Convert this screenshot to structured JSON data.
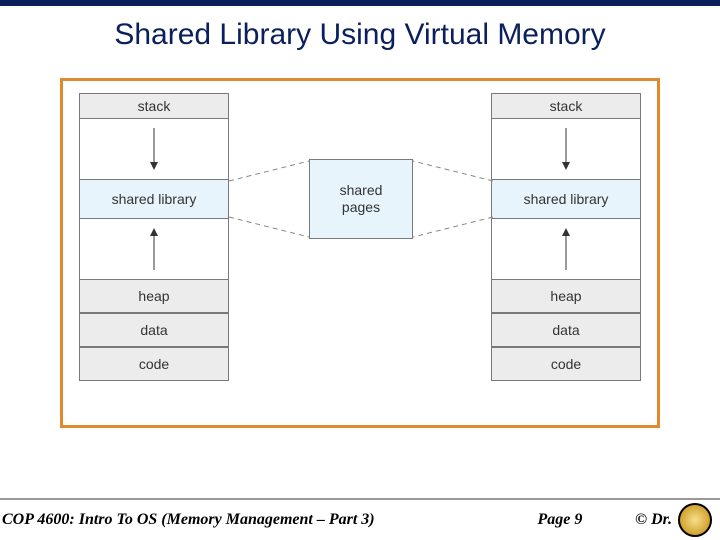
{
  "title": "Shared Library Using Virtual Memory",
  "diagram": {
    "left_segments": [
      "stack",
      "shared library",
      "heap",
      "data",
      "code"
    ],
    "right_segments": [
      "stack",
      "shared library",
      "heap",
      "data",
      "code"
    ],
    "center_label": "shared\npages"
  },
  "footer": {
    "course": "COP 4600: Intro To OS  (Memory Management – Part 3)",
    "page": "Page 9",
    "copyright": "© Dr."
  }
}
